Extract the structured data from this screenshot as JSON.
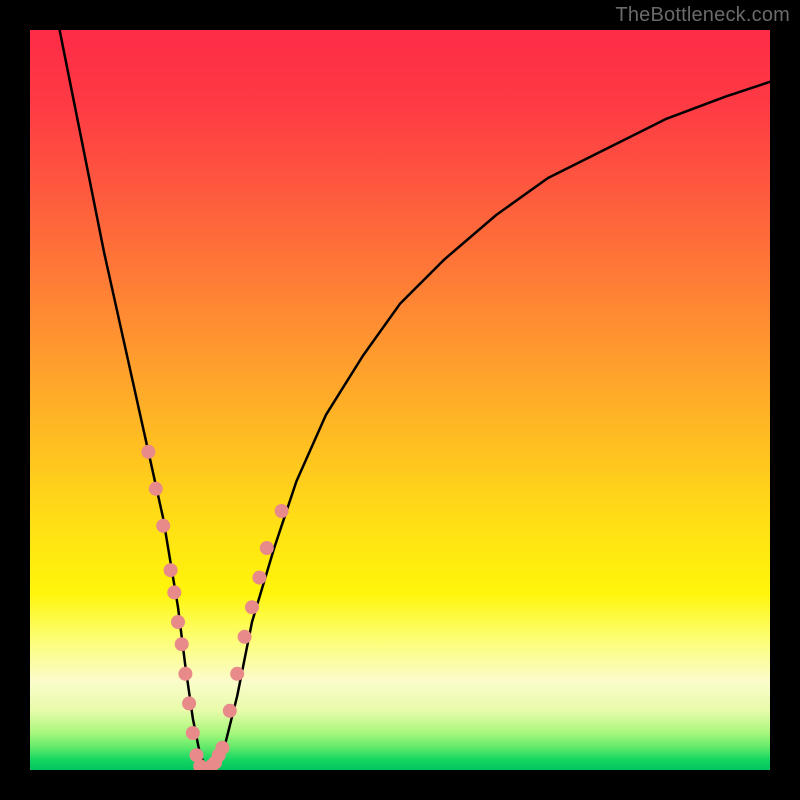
{
  "watermark": "TheBottleneck.com",
  "chart_data": {
    "type": "line",
    "title": "",
    "xlabel": "",
    "ylabel": "",
    "xlim": [
      0,
      100
    ],
    "ylim": [
      0,
      100
    ],
    "background_gradient": {
      "orientation": "vertical",
      "stops": [
        {
          "pct": 0,
          "color": "#fe2b46"
        },
        {
          "pct": 34,
          "color": "#ff7d36"
        },
        {
          "pct": 68,
          "color": "#ffe313"
        },
        {
          "pct": 88,
          "color": "#fbfccb"
        },
        {
          "pct": 100,
          "color": "#00c45e"
        }
      ]
    },
    "series": [
      {
        "name": "bottleneck-curve",
        "color": "#000000",
        "x": [
          4,
          6,
          8,
          10,
          12,
          14,
          16,
          18,
          20,
          21,
          22,
          23,
          24,
          25,
          26,
          28,
          30,
          33,
          36,
          40,
          45,
          50,
          56,
          63,
          70,
          78,
          86,
          94,
          100
        ],
        "y": [
          100,
          90,
          80,
          70,
          61,
          52,
          43,
          34,
          22,
          14,
          7,
          2,
          0,
          0,
          2,
          10,
          20,
          30,
          39,
          48,
          56,
          63,
          69,
          75,
          80,
          84,
          88,
          91,
          93
        ]
      }
    ],
    "markers": {
      "name": "sample-points",
      "color": "#e88a8a",
      "radius_px": 7,
      "points_xy": [
        [
          16,
          43
        ],
        [
          17,
          38
        ],
        [
          18,
          33
        ],
        [
          19,
          27
        ],
        [
          19.5,
          24
        ],
        [
          20,
          20
        ],
        [
          20.5,
          17
        ],
        [
          21,
          13
        ],
        [
          21.5,
          9
        ],
        [
          22,
          5
        ],
        [
          22.5,
          2
        ],
        [
          23,
          0.5
        ],
        [
          23.5,
          0
        ],
        [
          24,
          0
        ],
        [
          24.5,
          0.5
        ],
        [
          25,
          1
        ],
        [
          25.5,
          2
        ],
        [
          26,
          3
        ],
        [
          27,
          8
        ],
        [
          28,
          13
        ],
        [
          29,
          18
        ],
        [
          30,
          22
        ],
        [
          31,
          26
        ],
        [
          32,
          30
        ],
        [
          34,
          35
        ]
      ]
    }
  }
}
